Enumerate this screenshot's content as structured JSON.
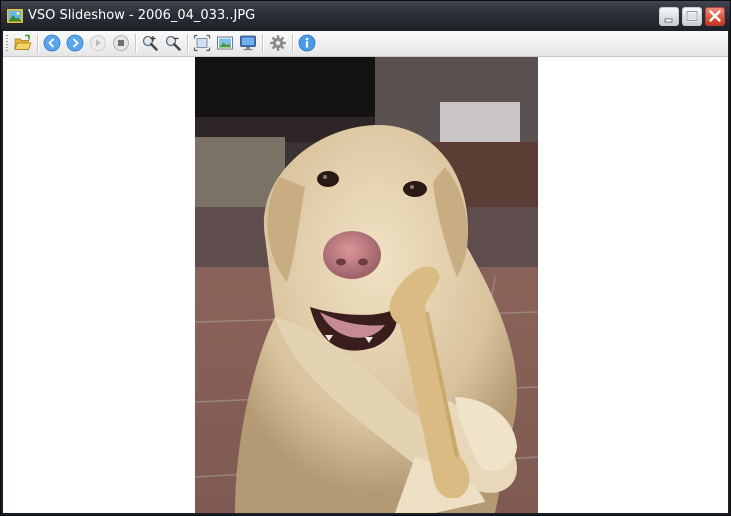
{
  "window": {
    "title": "VSO Slideshow - 2006_04_033..JPG"
  },
  "toolbar": {
    "buttons": [
      {
        "name": "open-folder",
        "icon": "folder-open-icon",
        "enabled": true
      },
      {
        "name": "previous",
        "icon": "arrow-left-icon",
        "enabled": true
      },
      {
        "name": "next",
        "icon": "arrow-right-icon",
        "enabled": true
      },
      {
        "name": "play",
        "icon": "play-icon",
        "enabled": false
      },
      {
        "name": "stop",
        "icon": "stop-icon",
        "enabled": true
      },
      {
        "name": "zoom-in",
        "icon": "zoom-in-icon",
        "enabled": true
      },
      {
        "name": "zoom-out",
        "icon": "zoom-out-icon",
        "enabled": true
      },
      {
        "name": "fit-to-window",
        "icon": "fit-window-icon",
        "enabled": true
      },
      {
        "name": "set-wallpaper",
        "icon": "picture-icon",
        "enabled": true
      },
      {
        "name": "fullscreen",
        "icon": "monitor-icon",
        "enabled": true
      },
      {
        "name": "settings",
        "icon": "gear-icon",
        "enabled": true
      },
      {
        "name": "about",
        "icon": "info-icon",
        "enabled": true
      }
    ]
  },
  "image": {
    "subject": "yellow labrador chewing a bone on tiled floor"
  },
  "colors": {
    "titlebar": "#2a2f37",
    "close_button": "#c8321c",
    "accent_blue": "#3c8fe0"
  }
}
